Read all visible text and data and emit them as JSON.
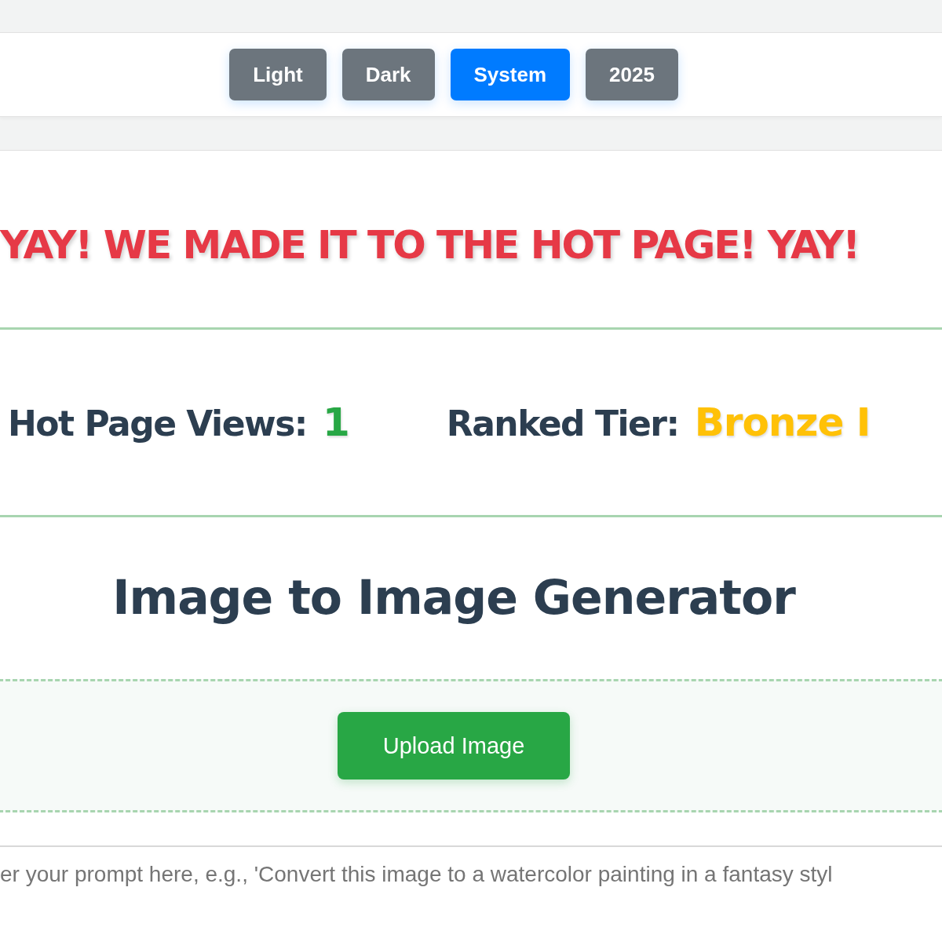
{
  "theme_buttons": [
    {
      "label": "Light",
      "selected": false
    },
    {
      "label": "Dark",
      "selected": false
    },
    {
      "label": "System",
      "selected": true
    },
    {
      "label": "2025",
      "selected": false
    }
  ],
  "banner": "YAY! WE MADE IT TO THE HOT PAGE! YAY!",
  "stats": [
    {
      "label": "Hot Page Views:",
      "value": "1",
      "color": "#28a745"
    },
    {
      "label": "Ranked Tier:",
      "value": "Bronze I",
      "color": "#ffc107"
    }
  ],
  "generator": {
    "title": "Image to Image Generator",
    "upload_button": "Upload Image",
    "prompt": {
      "placeholder": "er your prompt here, e.g., 'Convert this image to a watercolor painting in a fantasy styl"
    }
  }
}
